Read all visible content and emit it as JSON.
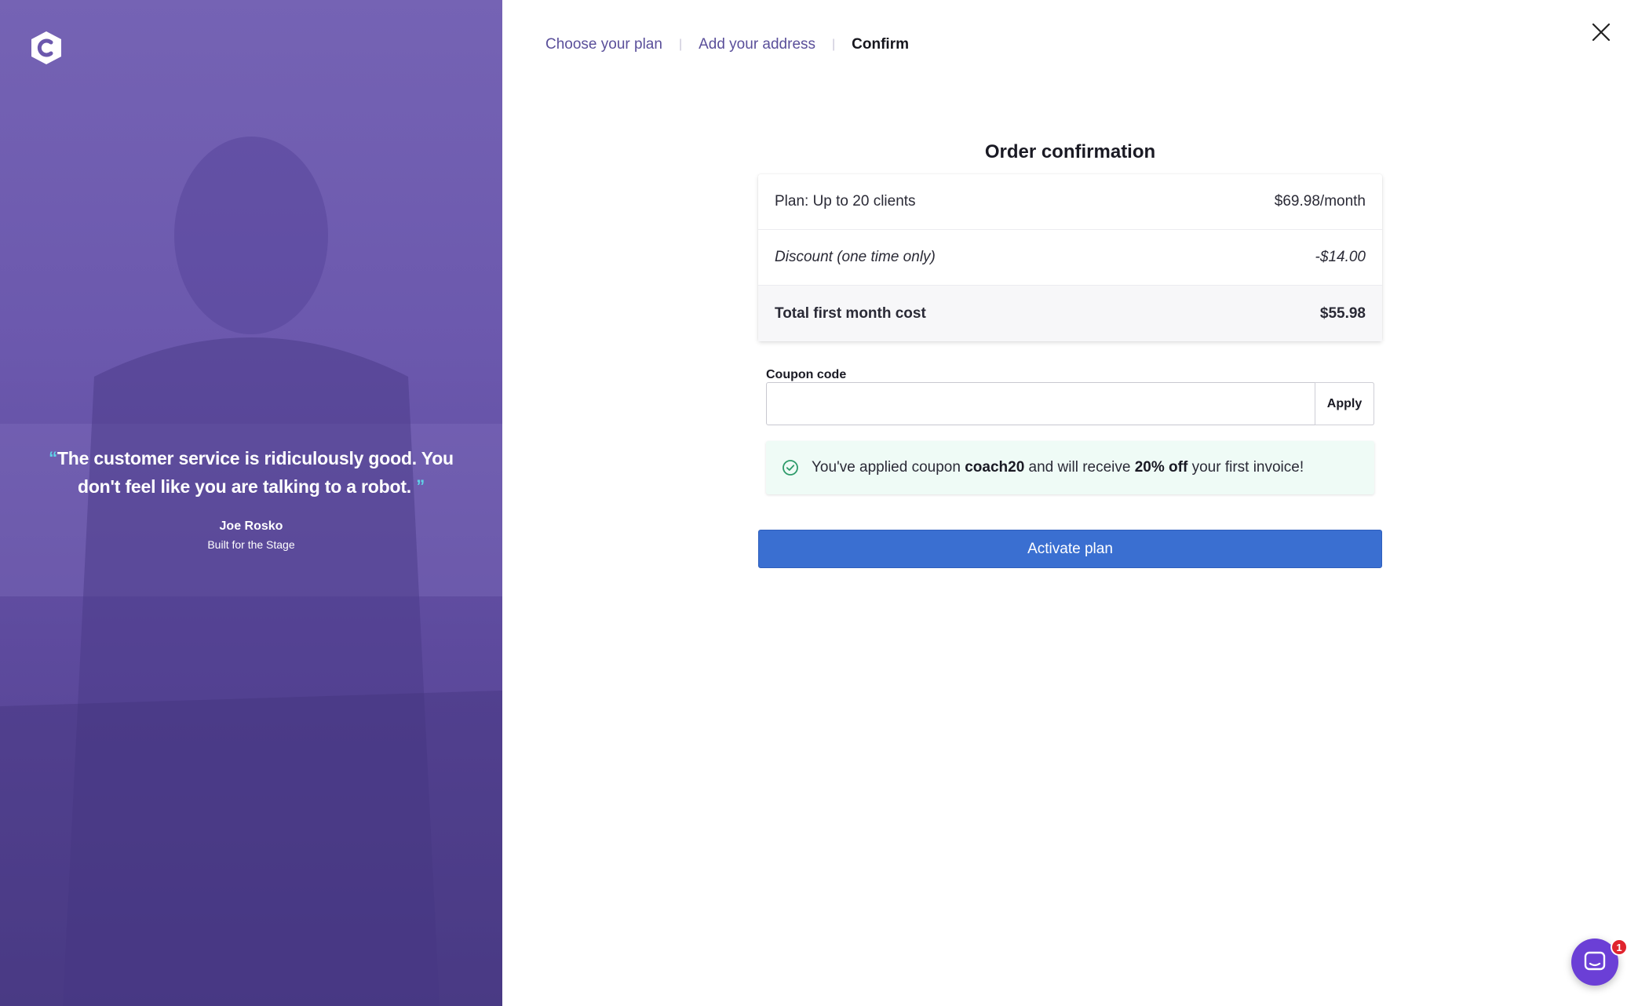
{
  "colors": {
    "brand_purple": "#6b58ad",
    "accent_blue": "#3a6fd1",
    "success_green": "#2e9b6a",
    "quote_mark": "#5fd3e8"
  },
  "testimonial": {
    "open_mark": "“",
    "text": "The customer service is ridiculously good. You don't feel like you are talking to a robot.",
    "close_mark": "”",
    "author": "Joe Rosko",
    "company": "Built for the Stage"
  },
  "steps": [
    {
      "label": "Choose your plan"
    },
    {
      "label": "Add your address"
    },
    {
      "label": "Confirm"
    }
  ],
  "step_separator": "|",
  "order": {
    "title": "Order confirmation",
    "rows": [
      {
        "label": "Plan: Up to 20 clients",
        "value": "$69.98/month"
      },
      {
        "label": "Discount (one time only)",
        "value": "-$14.00"
      },
      {
        "label": "Total first month cost",
        "value": "$55.98"
      }
    ]
  },
  "coupon": {
    "label": "Coupon code",
    "value": "",
    "placeholder": "",
    "apply_label": "Apply",
    "success": {
      "prefix": "You've applied coupon ",
      "code": "coach20",
      "middle": " and will receive ",
      "amount": "20% off",
      "suffix": " your first invoice!"
    }
  },
  "activate_label": "Activate plan",
  "chat": {
    "badge": "1"
  },
  "icons": {
    "logo": "brand-logo-icon",
    "close": "close-icon",
    "check": "check-circle-icon",
    "chat": "chat-bubble-icon"
  }
}
